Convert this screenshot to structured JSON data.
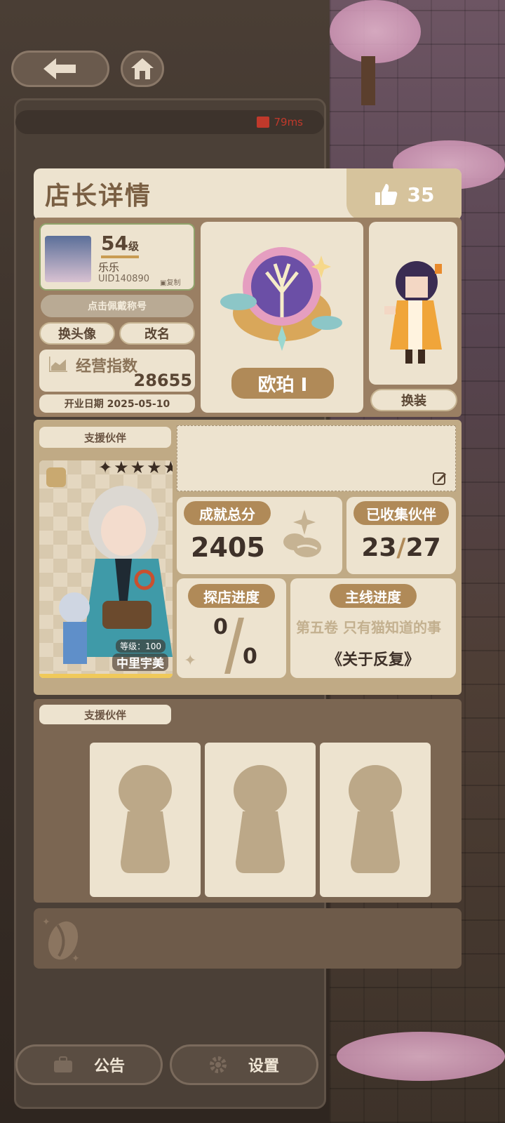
{
  "background_color": "#3a2f27",
  "status": {
    "ping": "79ms"
  },
  "nav": {
    "back_icon": "back-arrow-icon",
    "home_icon": "home-icon"
  },
  "modal": {
    "title": "店长详情",
    "likes": "35",
    "profile": {
      "level": "54",
      "level_unit": "级",
      "name": "乐乐",
      "uid": "UID140890",
      "copy_label": "复制",
      "title_button": "点击佩戴称号",
      "change_avatar": "换头像",
      "rename": "改名",
      "business_index_label": "经营指数",
      "business_index_value": "28655",
      "open_date": "开业日期 2025-05-10"
    },
    "badge": {
      "rank": "欧珀 I"
    },
    "outfit": {
      "change_outfit": "换装"
    },
    "support_partner": {
      "tab_label": "支援伙伴",
      "level_text": "等级：100",
      "name": "中里宇美",
      "stars": 4
    },
    "stats": {
      "achievement_label": "成就总分",
      "achievement_value": "2405",
      "collected_label": "已收集伙伴",
      "collected_value": "23",
      "collected_total": "27",
      "explore_label": "探店进度",
      "explore_value": "0",
      "explore_total": "0",
      "story_label": "主线进度",
      "story_chapter": "第五卷 只有猫知道的事",
      "story_episode": "《关于反复》"
    },
    "support_slots": {
      "tab_label": "支援伙伴"
    }
  },
  "bottom": {
    "notice": "公告",
    "settings": "设置"
  },
  "colors": {
    "cream": "#ede3cf",
    "frame": "#9a7f63",
    "gold": "#b08a58",
    "text_brown": "#5a4634"
  }
}
